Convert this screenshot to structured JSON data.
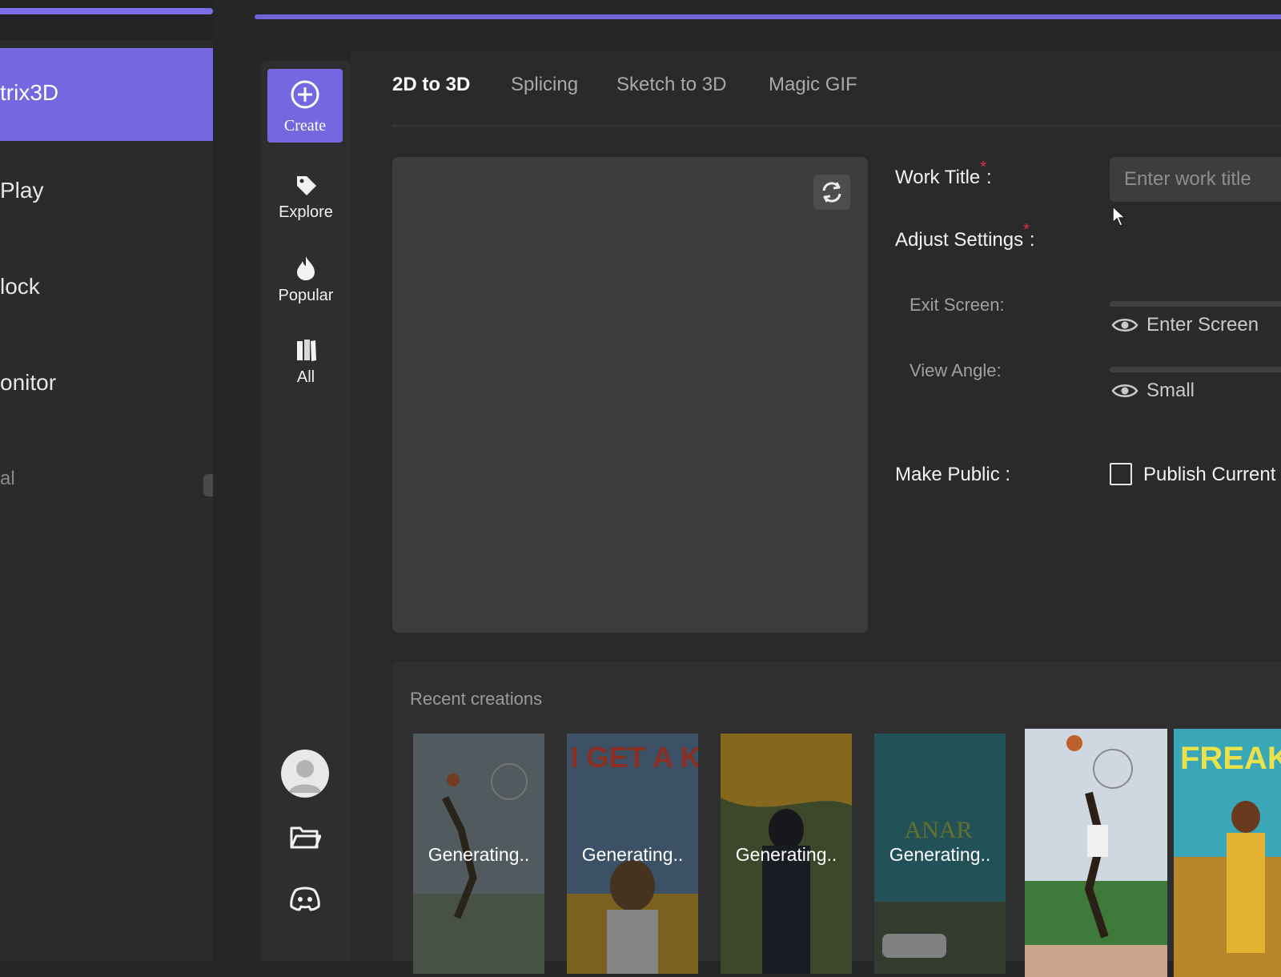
{
  "left_nav": {
    "items": [
      {
        "label": "trix3D",
        "active": true
      },
      {
        "label": "Play"
      },
      {
        "label": "lock"
      },
      {
        "label": "onitor"
      },
      {
        "label": "al"
      }
    ]
  },
  "rail": {
    "create_label": "Create",
    "items": [
      {
        "label": "Explore",
        "icon": "tag-icon"
      },
      {
        "label": "Popular",
        "icon": "flame-icon"
      },
      {
        "label": "All",
        "icon": "books-icon"
      }
    ],
    "bottom_icons": [
      "avatar",
      "folder-icon",
      "discord-icon"
    ]
  },
  "tabs": [
    {
      "label": "2D to 3D",
      "active": true
    },
    {
      "label": "Splicing"
    },
    {
      "label": "Sketch to 3D"
    },
    {
      "label": "Magic GIF"
    }
  ],
  "form": {
    "work_title_label": "Work Title",
    "work_title_placeholder": "Enter work title",
    "adjust_settings_label": "Adjust Settings",
    "exit_screen_label": "Exit Screen",
    "exit_screen_value": "Enter Screen",
    "view_angle_label": "View Angle",
    "view_angle_value": "Small",
    "make_public_label": "Make Public :",
    "publish_label": "Publish Current",
    "colon": ":",
    "required_mark": "*"
  },
  "recent": {
    "title": "Recent creations",
    "cards": [
      {
        "status": "Generating.."
      },
      {
        "status": "Generating..",
        "poster_text": "CAN I GET A KISS?"
      },
      {
        "status": "Generating.."
      },
      {
        "status": "Generating..",
        "poster_text": "ANAR"
      },
      {
        "status": ""
      },
      {
        "status": "",
        "poster_text": "FREAK"
      }
    ]
  },
  "colors": {
    "accent": "#7467df",
    "required": "#e0303a"
  }
}
